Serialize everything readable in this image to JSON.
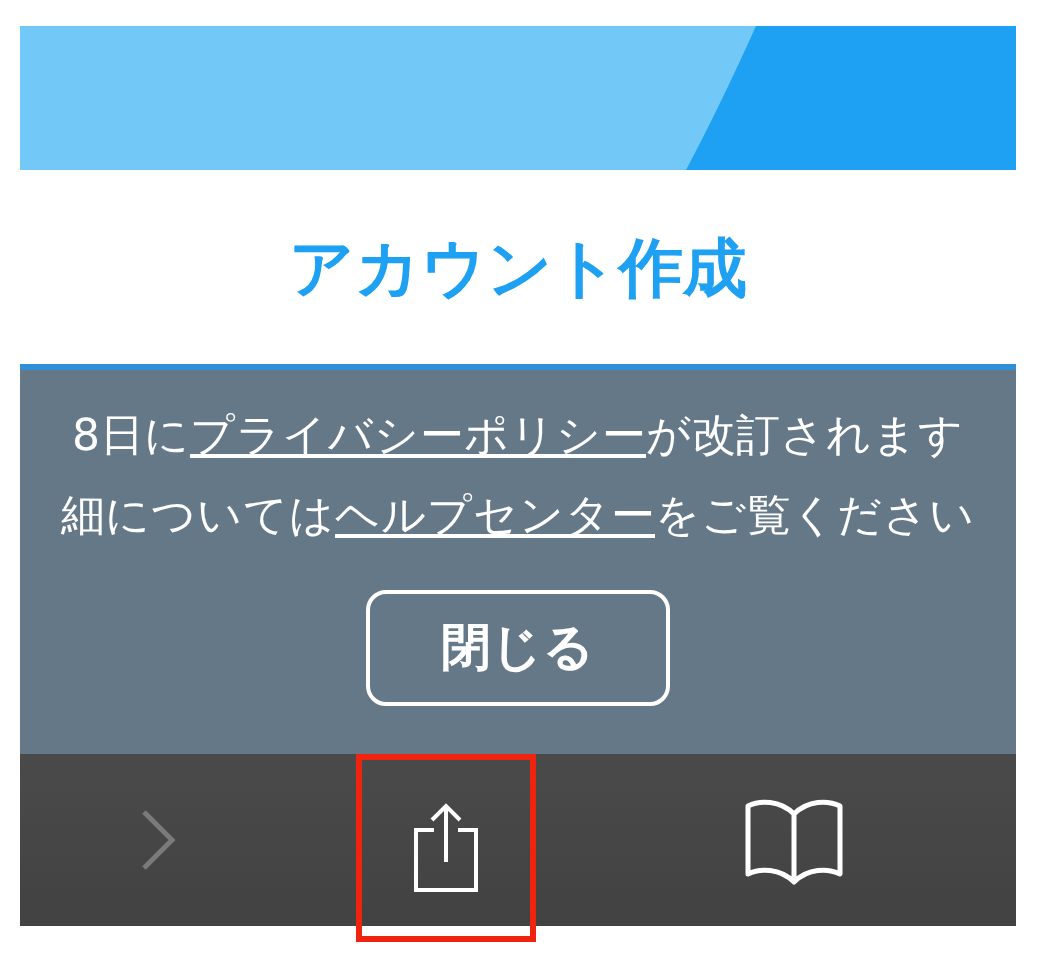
{
  "header": {
    "title": "アカウント作成"
  },
  "notice": {
    "lines": [
      [
        {
          "kind": "text",
          "text": "8日に"
        },
        {
          "kind": "link",
          "text": "プライバシーポリシー"
        },
        {
          "kind": "text",
          "text": "が改訂されます"
        }
      ],
      [
        {
          "kind": "text",
          "text": "細については"
        },
        {
          "kind": "link",
          "text": "ヘルプセンター"
        },
        {
          "kind": "text",
          "text": "をご覧ください"
        }
      ]
    ],
    "close_button": "閉じる"
  },
  "toolbar": [
    {
      "kind": "forward",
      "disabled": true,
      "highlighted": false
    },
    {
      "kind": "share",
      "disabled": false,
      "highlighted": true
    },
    {
      "kind": "bookmarks",
      "disabled": false,
      "highlighted": false
    }
  ]
}
